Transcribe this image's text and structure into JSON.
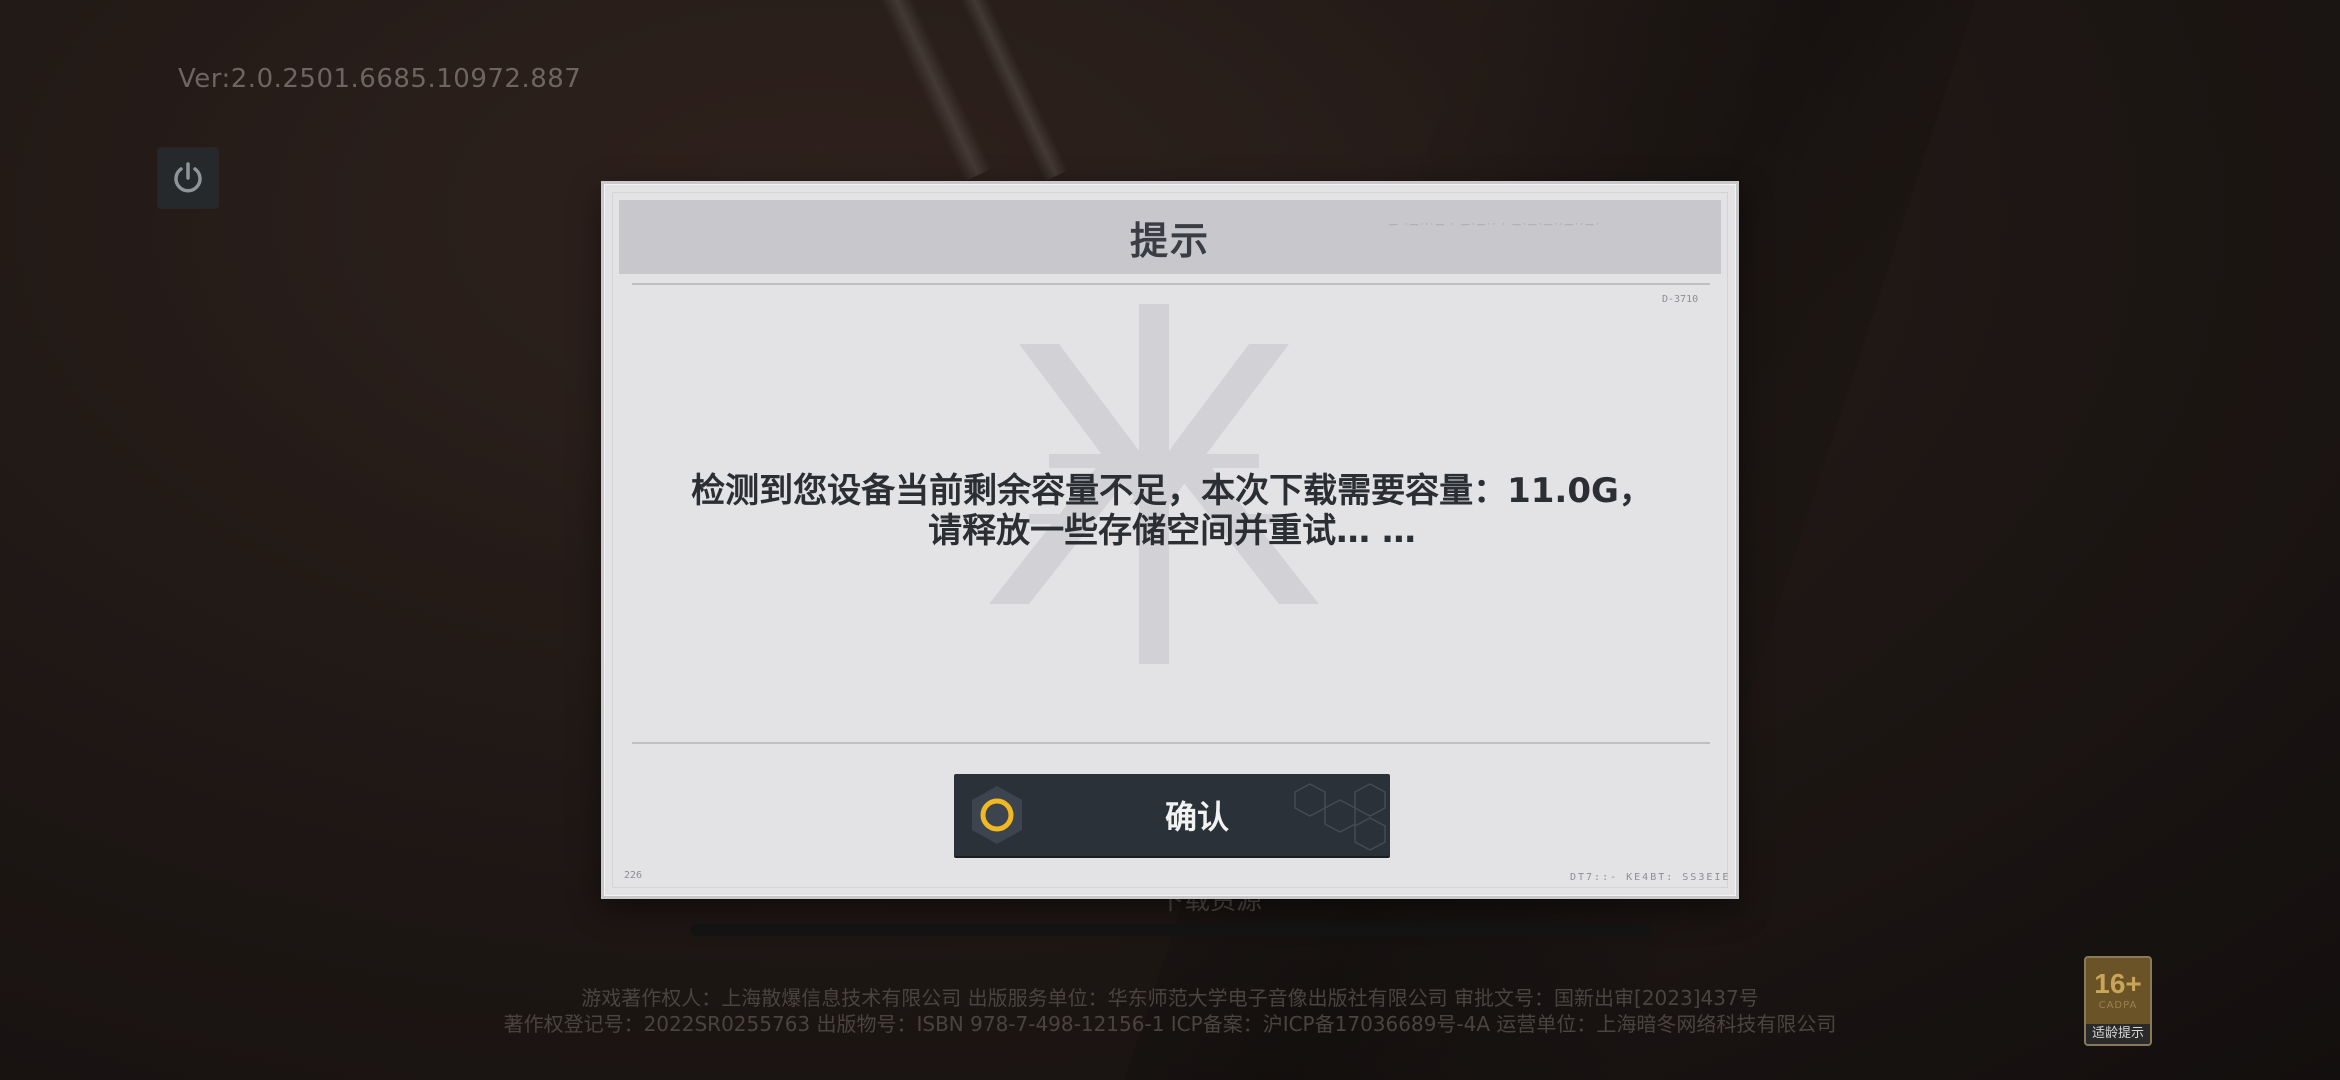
{
  "app": {
    "version": "Ver:2.0.2501.6685.10972.887"
  },
  "background": {
    "loading_label": "下载资源",
    "footer_line1": "游戏著作权人：上海散爆信息技术有限公司  出版服务单位：华东师范大学电子音像出版社有限公司  审批文号：国新出审[2023]437号",
    "footer_line2": "著作权登记号：2022SR0255763 出版物号：ISBN 978-7-498-12156-1 ICP备案：沪ICP备17036689号-4A 运营单位：上海暗冬网络科技有限公司",
    "age_rating": {
      "number": "16+",
      "org": "CADPA",
      "label": "适龄提示"
    }
  },
  "dialog": {
    "title": "提示",
    "header_micro_text": "— ·—···— · —·—·· · —·—·—··—··—·",
    "code_top_right": "D-3710",
    "code_bottom_left": "226",
    "code_bottom_right": "DT7::- KE4BT: SS3EIE",
    "message_line1": "检测到您设备当前剩余容量不足，本次下载需要容量：11.0G，",
    "message_line2": "请释放一些存储空间并重试… …",
    "confirm_label": "确认"
  },
  "colors": {
    "dialog_bg": "#e3e3e6",
    "header_bg": "#c8c8cc",
    "button_bg": "#2a3139",
    "button_ring": "#f2b824"
  }
}
